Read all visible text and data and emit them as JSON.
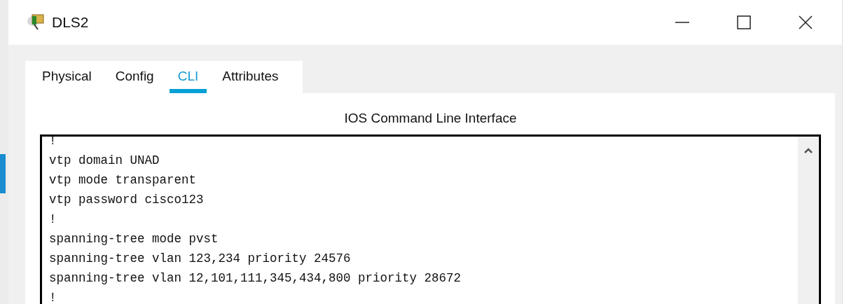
{
  "window": {
    "title": "DLS2"
  },
  "tabs": [
    {
      "label": "Physical",
      "selected": false
    },
    {
      "label": "Config",
      "selected": false
    },
    {
      "label": "CLI",
      "selected": true
    },
    {
      "label": "Attributes",
      "selected": false
    }
  ],
  "panel_title": "IOS Command Line Interface",
  "terminal": {
    "lines": [
      "!",
      "vtp domain UNAD",
      "vtp mode transparent",
      "vtp password cisco123",
      "!",
      "spanning-tree mode pvst",
      "spanning-tree vlan 123,234 priority 24576",
      "spanning-tree vlan 12,101,111,345,434,800 priority 28672",
      "!"
    ]
  }
}
